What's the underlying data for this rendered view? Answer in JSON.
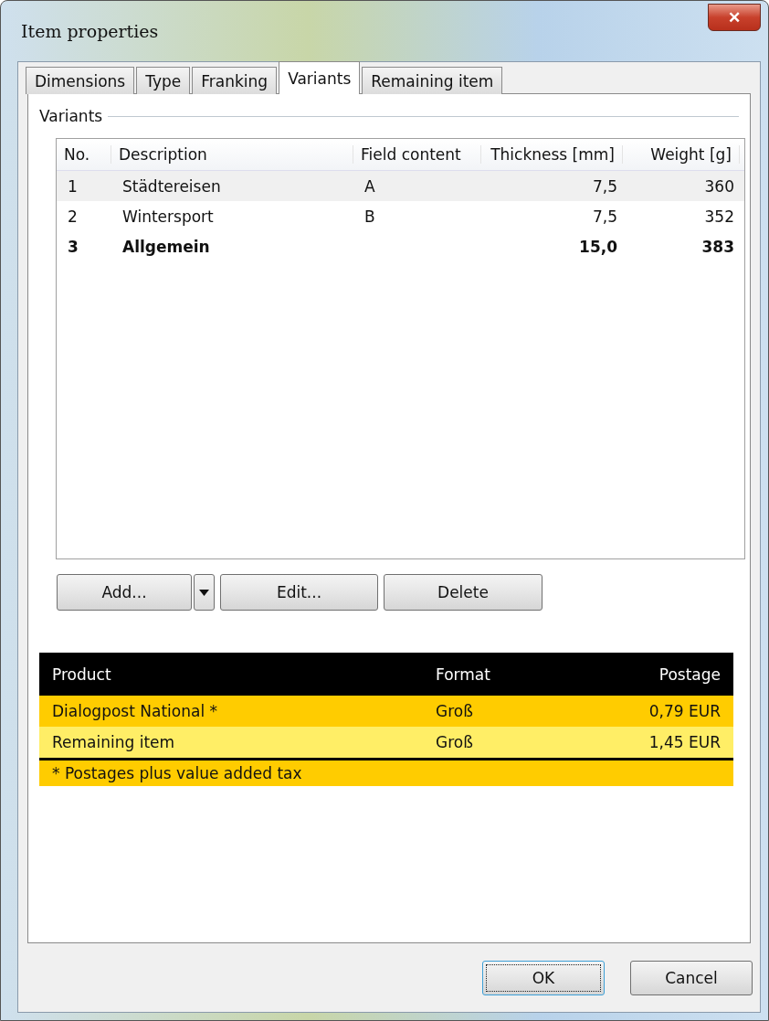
{
  "window": {
    "title": "Item properties",
    "close": "✕"
  },
  "tabs": [
    {
      "label": "Dimensions",
      "selected": false
    },
    {
      "label": "Type",
      "selected": false
    },
    {
      "label": "Franking",
      "selected": false
    },
    {
      "label": "Variants",
      "selected": true
    },
    {
      "label": "Remaining item",
      "selected": false
    }
  ],
  "group": {
    "title": "Variants"
  },
  "table": {
    "columns": [
      "No.",
      "Description",
      "Field content",
      "Thickness [mm]",
      "Weight [g]"
    ],
    "rows": [
      {
        "cells": [
          "1",
          "Städtereisen",
          "A",
          "7,5",
          "360"
        ],
        "selected": true,
        "bold": false
      },
      {
        "cells": [
          "2",
          "Wintersport",
          "B",
          "7,5",
          "352"
        ],
        "selected": false,
        "bold": false
      },
      {
        "cells": [
          "3",
          "Allgemein",
          "",
          "15,0",
          "383"
        ],
        "selected": false,
        "bold": true
      }
    ]
  },
  "actions": [
    {
      "label": "Add...",
      "dropdown": true
    },
    {
      "label": "Edit...",
      "dropdown": false
    },
    {
      "label": "Delete",
      "dropdown": false
    }
  ],
  "postage": {
    "columns": [
      "Product",
      "Format",
      "Postage"
    ],
    "rows": [
      {
        "cells": [
          "Dialogpost National *",
          "Groß",
          "0,79 EUR"
        ],
        "color": "#ffcc00"
      },
      {
        "cells": [
          "Remaining item",
          "Groß",
          "1,45 EUR"
        ],
        "color": "#ffee66"
      }
    ],
    "note": "* Postages plus value added tax"
  },
  "buttons": [
    {
      "label": "OK",
      "default": true
    },
    {
      "label": "Cancel",
      "default": false
    }
  ]
}
